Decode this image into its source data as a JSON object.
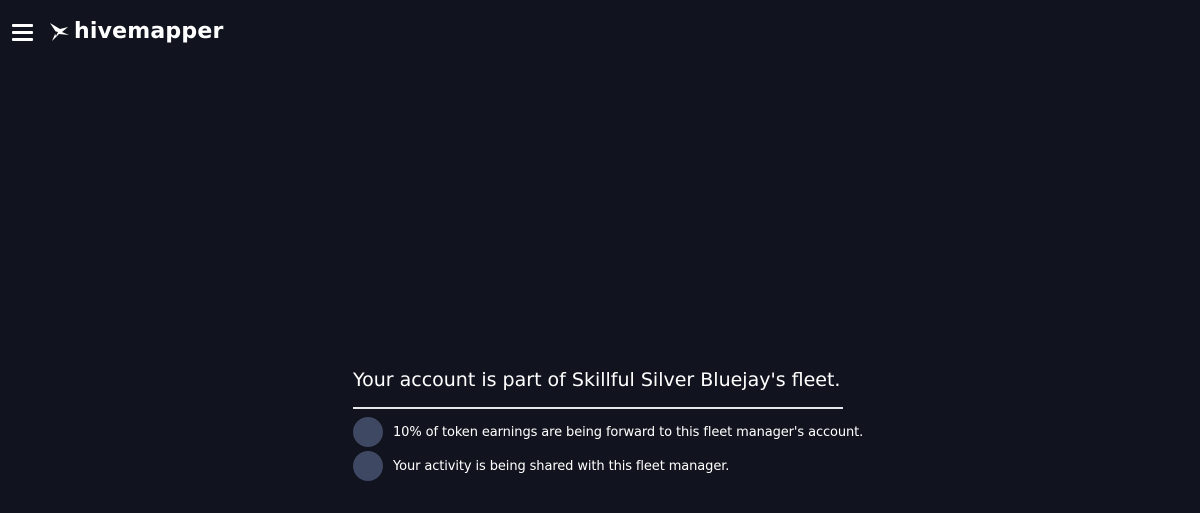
{
  "header": {
    "menu_icon": "hamburger-menu-icon",
    "logo_icon": "hivemapper-bee-icon",
    "logo_text": "hivemapper"
  },
  "fleet": {
    "title": "Your account is part of Skillful Silver Bluejay's fleet.",
    "items": [
      {
        "icon": "circle-icon",
        "text": "10% of token earnings are being forward to this fleet manager's account."
      },
      {
        "icon": "circle-icon",
        "text": "Your activity is being shared with this fleet manager."
      }
    ]
  },
  "colors": {
    "background": "#11141e",
    "text": "#ffffff",
    "divider": "#e8e8ec",
    "dot": "#3f4862"
  }
}
